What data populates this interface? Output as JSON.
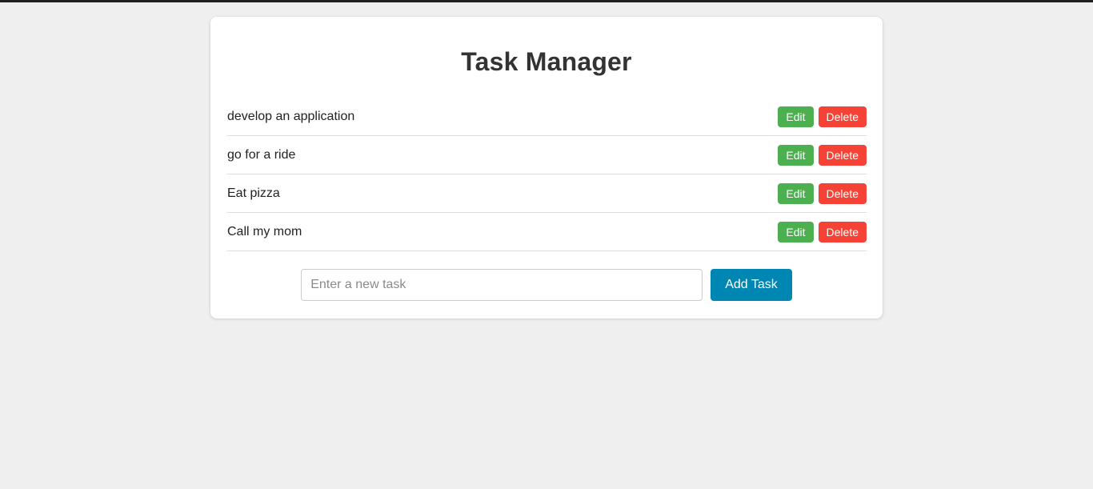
{
  "header": {
    "title": "Task Manager"
  },
  "tasks": [
    {
      "label": "develop an application",
      "edit_label": "Edit",
      "delete_label": "Delete"
    },
    {
      "label": "go for a ride",
      "edit_label": "Edit",
      "delete_label": "Delete"
    },
    {
      "label": "Eat pizza",
      "edit_label": "Edit",
      "delete_label": "Delete"
    },
    {
      "label": "Call my mom",
      "edit_label": "Edit",
      "delete_label": "Delete"
    }
  ],
  "add_form": {
    "input_value": "",
    "input_placeholder": "Enter a new task",
    "submit_label": "Add Task"
  },
  "colors": {
    "page_background": "#efefef",
    "card_background": "#ffffff",
    "top_strip": "#1f1f1f",
    "title_text": "#333333",
    "edit_green": "#4caf50",
    "delete_red": "#f44336",
    "add_blue": "#0086b3",
    "divider": "#dddddd",
    "input_border": "#cccccc",
    "placeholder_text": "#8a8a8a"
  }
}
